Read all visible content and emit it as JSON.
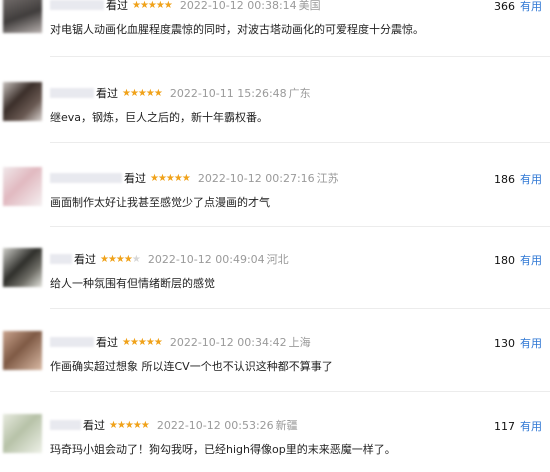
{
  "colors": {
    "star": "#f0a21a",
    "useful_link": "#2f77d4",
    "meta_gray": "#9a9a9a"
  },
  "reviews": [
    {
      "seen_label": "看过",
      "stars": "★★★★★",
      "stars_off": "",
      "rating": 5,
      "time": "2022-10-12 00:38:14",
      "location": "美国",
      "votes": "366",
      "useful": "有用",
      "comment": "对电锯人动画化血腥程度震惊的同时，对波古塔动画化的可爱程度十分震惊。"
    },
    {
      "seen_label": "看过",
      "stars": "★★★★★",
      "stars_off": "",
      "rating": 5,
      "time": "2022-10-11 15:26:48",
      "location": "广东",
      "votes": "",
      "useful": "",
      "comment": "继eva，钢炼，巨人之后的，新十年霸权番。"
    },
    {
      "seen_label": "看过",
      "stars": "★★★★★",
      "stars_off": "",
      "rating": 5,
      "time": "2022-10-12 00:27:16",
      "location": "江苏",
      "votes": "186",
      "useful": "有用",
      "comment": "画面制作太好让我甚至感觉少了点漫画的才气"
    },
    {
      "seen_label": "看过",
      "stars": "★★★★",
      "stars_off": "★",
      "rating": 4,
      "time": "2022-10-12 00:49:04",
      "location": "河北",
      "votes": "180",
      "useful": "有用",
      "comment": "给人一种氛围有但情绪断层的感觉"
    },
    {
      "seen_label": "看过",
      "stars": "★★★★★",
      "stars_off": "",
      "rating": 5,
      "time": "2022-10-12 00:34:42",
      "location": "上海",
      "votes": "130",
      "useful": "有用",
      "comment": "作画确实超过想象 所以连CV一个也不认识这种都不算事了"
    },
    {
      "seen_label": "看过",
      "stars": "★★★★★",
      "stars_off": "",
      "rating": 5,
      "time": "2022-10-12 00:53:26",
      "location": "新疆",
      "votes": "117",
      "useful": "有用",
      "comment": "玛奇玛小姐会动了！狗勾我呀，已经high得像op里的末来恶魔一样了。"
    }
  ]
}
